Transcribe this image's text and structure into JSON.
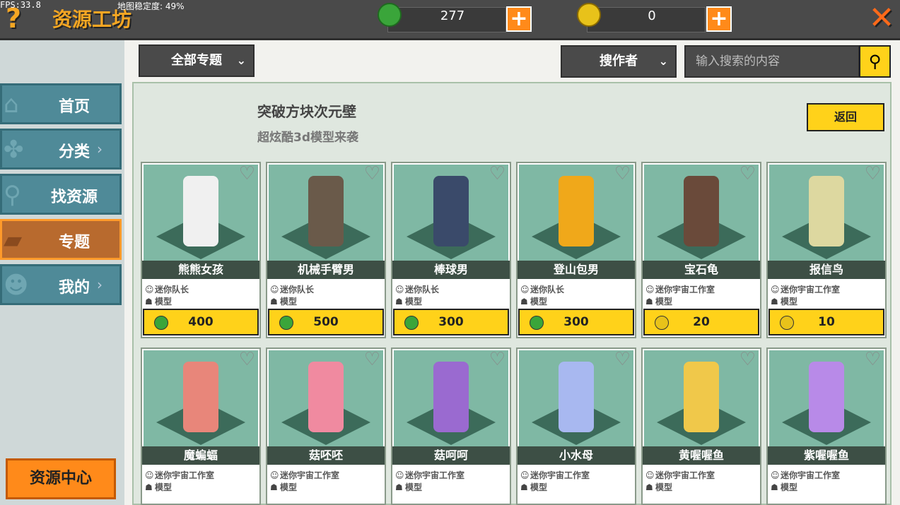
{
  "debug": {
    "fps": "FPS:33.8",
    "map_stability": "地图稳定度: 49%"
  },
  "header": {
    "title": "资源工坊",
    "help_icon": "question-icon",
    "close_icon": "close-icon"
  },
  "currencies": [
    {
      "name": "gem",
      "icon": "green-gem-icon",
      "value": "277",
      "color": "#3aa53a"
    },
    {
      "name": "coin",
      "icon": "gold-coin-icon",
      "value": "0",
      "color": "#e8c21a"
    }
  ],
  "sidebar": {
    "items": [
      {
        "label": "首页",
        "icon": "home-icon",
        "chevron": false,
        "active": false
      },
      {
        "label": "分类",
        "icon": "category-icon",
        "chevron": true,
        "active": false
      },
      {
        "label": "找资源",
        "icon": "search-icon",
        "chevron": false,
        "active": false
      },
      {
        "label": "专题",
        "icon": "topic-icon",
        "chevron": false,
        "active": true
      },
      {
        "label": "我的",
        "icon": "profile-icon",
        "chevron": true,
        "active": false
      }
    ],
    "resource_center": "资源中心"
  },
  "filters": {
    "topic_dropdown": "全部专题",
    "search_type": "搜作者",
    "search_placeholder": "输入搜索的内容"
  },
  "topic": {
    "title": "突破方块次元壁",
    "subtitle": "超炫酷3d模型来袭",
    "back_label": "返回"
  },
  "colors": {
    "accent_orange": "#ff8a1a",
    "price_yellow": "#ffd21a",
    "panel_green": "#7fb8a4"
  },
  "cards": [
    {
      "name": "熊熊女孩",
      "author": "迷你队长",
      "type": "模型",
      "price": "400",
      "currency": "gem",
      "figure_color": "#f0f0f0"
    },
    {
      "name": "机械手臂男",
      "author": "迷你队长",
      "type": "模型",
      "price": "500",
      "currency": "gem",
      "figure_color": "#6a5a4a"
    },
    {
      "name": "棒球男",
      "author": "迷你队长",
      "type": "模型",
      "price": "300",
      "currency": "gem",
      "figure_color": "#3a4a6a"
    },
    {
      "name": "登山包男",
      "author": "迷你队长",
      "type": "模型",
      "price": "300",
      "currency": "gem",
      "figure_color": "#f0a81a"
    },
    {
      "name": "宝石龟",
      "author": "迷你宇宙工作室",
      "type": "模型",
      "price": "20",
      "currency": "coin",
      "figure_color": "#6a4a3a"
    },
    {
      "name": "报信鸟",
      "author": "迷你宇宙工作室",
      "type": "模型",
      "price": "10",
      "currency": "coin",
      "figure_color": "#ddd8a0"
    },
    {
      "name": "魔蝙蝠",
      "author": "迷你宇宙工作室",
      "type": "模型",
      "figure_color": "#e8867a"
    },
    {
      "name": "菇呸呸",
      "author": "迷你宇宙工作室",
      "type": "模型",
      "figure_color": "#f08aa0"
    },
    {
      "name": "菇呵呵",
      "author": "迷你宇宙工作室",
      "type": "模型",
      "figure_color": "#9a6ad0"
    },
    {
      "name": "小水母",
      "author": "迷你宇宙工作室",
      "type": "模型",
      "figure_color": "#a8b8f0"
    },
    {
      "name": "黄喔喔鱼",
      "author": "迷你宇宙工作室",
      "type": "模型",
      "figure_color": "#f0c84a"
    },
    {
      "name": "紫喔喔鱼",
      "author": "迷你宇宙工作室",
      "type": "模型",
      "figure_color": "#b88ae8"
    }
  ]
}
